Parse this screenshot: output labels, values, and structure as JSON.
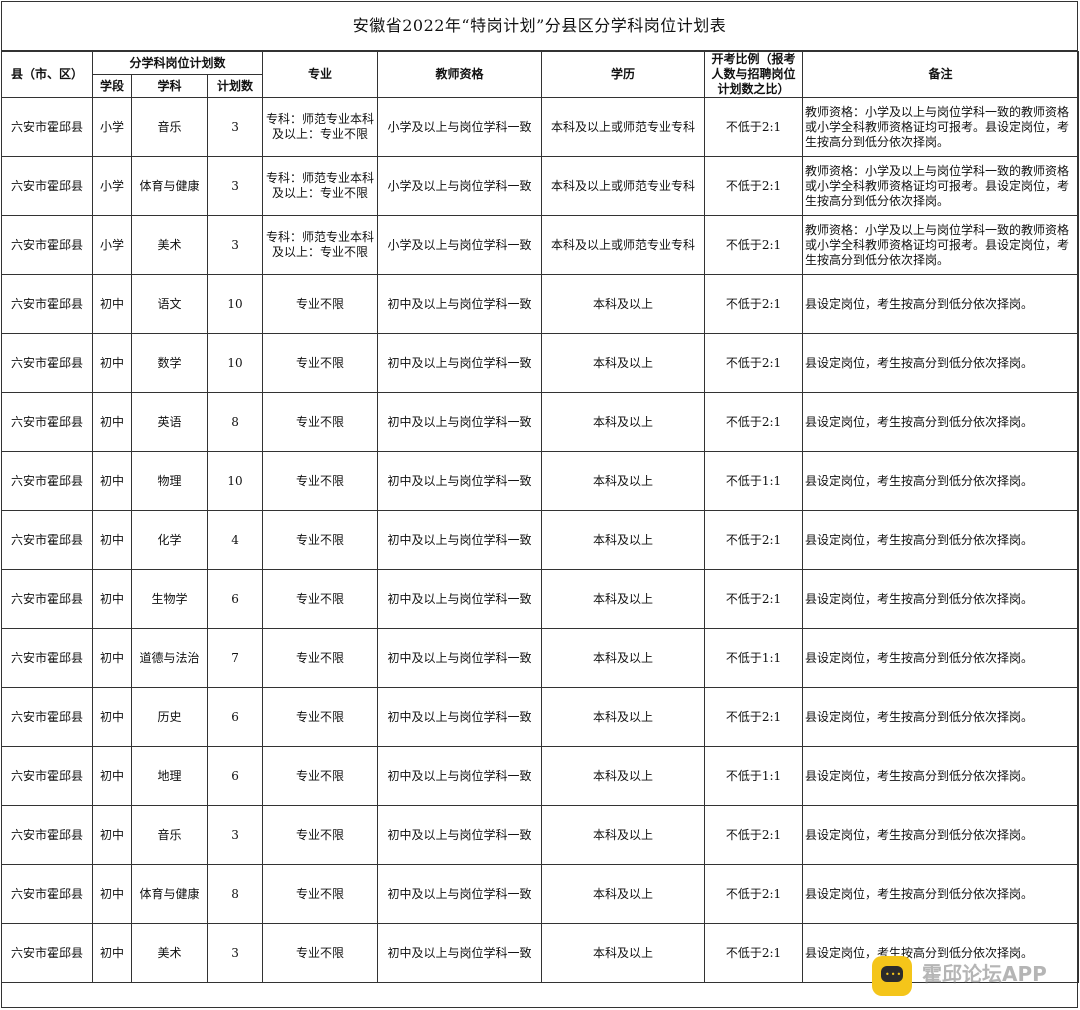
{
  "title": "安徽省2022年“特岗计划”分县区分学科岗位计划表",
  "headers": {
    "county": "县（市、区）",
    "plan_group": "分学科岗位计划数",
    "stage": "学段",
    "subject": "学科",
    "count": "计划数",
    "major": "专业",
    "qualification": "教师资格",
    "education": "学历",
    "ratio": "开考比例（报考人数与招聘岗位计划数之比）",
    "remark": "备注"
  },
  "rows": [
    {
      "county": "六安市霍邱县",
      "stage": "小学",
      "subject": "音乐",
      "count": "3",
      "major": "专科：师范专业本科及以上：专业不限",
      "qualification": "小学及以上与岗位学科一致",
      "education": "本科及以上或师范专业专科",
      "ratio": "不低于2:1",
      "remark": "教师资格：小学及以上与岗位学科一致的教师资格或小学全科教师资格证均可报考。县设定岗位，考生按高分到低分依次择岗。"
    },
    {
      "county": "六安市霍邱县",
      "stage": "小学",
      "subject": "体育与健康",
      "count": "3",
      "major": "专科：师范专业本科及以上：专业不限",
      "qualification": "小学及以上与岗位学科一致",
      "education": "本科及以上或师范专业专科",
      "ratio": "不低于2:1",
      "remark": "教师资格：小学及以上与岗位学科一致的教师资格或小学全科教师资格证均可报考。县设定岗位，考生按高分到低分依次择岗。"
    },
    {
      "county": "六安市霍邱县",
      "stage": "小学",
      "subject": "美术",
      "count": "3",
      "major": "专科：师范专业本科及以上：专业不限",
      "qualification": "小学及以上与岗位学科一致",
      "education": "本科及以上或师范专业专科",
      "ratio": "不低于2:1",
      "remark": "教师资格：小学及以上与岗位学科一致的教师资格或小学全科教师资格证均可报考。县设定岗位，考生按高分到低分依次择岗。"
    },
    {
      "county": "六安市霍邱县",
      "stage": "初中",
      "subject": "语文",
      "count": "10",
      "major": "专业不限",
      "qualification": "初中及以上与岗位学科一致",
      "education": "本科及以上",
      "ratio": "不低于2:1",
      "remark": "县设定岗位，考生按高分到低分依次择岗。"
    },
    {
      "county": "六安市霍邱县",
      "stage": "初中",
      "subject": "数学",
      "count": "10",
      "major": "专业不限",
      "qualification": "初中及以上与岗位学科一致",
      "education": "本科及以上",
      "ratio": "不低于2:1",
      "remark": "县设定岗位，考生按高分到低分依次择岗。"
    },
    {
      "county": "六安市霍邱县",
      "stage": "初中",
      "subject": "英语",
      "count": "8",
      "major": "专业不限",
      "qualification": "初中及以上与岗位学科一致",
      "education": "本科及以上",
      "ratio": "不低于2:1",
      "remark": "县设定岗位，考生按高分到低分依次择岗。"
    },
    {
      "county": "六安市霍邱县",
      "stage": "初中",
      "subject": "物理",
      "count": "10",
      "major": "专业不限",
      "qualification": "初中及以上与岗位学科一致",
      "education": "本科及以上",
      "ratio": "不低于1:1",
      "remark": "县设定岗位，考生按高分到低分依次择岗。"
    },
    {
      "county": "六安市霍邱县",
      "stage": "初中",
      "subject": "化学",
      "count": "4",
      "major": "专业不限",
      "qualification": "初中及以上与岗位学科一致",
      "education": "本科及以上",
      "ratio": "不低于2:1",
      "remark": "县设定岗位，考生按高分到低分依次择岗。"
    },
    {
      "county": "六安市霍邱县",
      "stage": "初中",
      "subject": "生物学",
      "count": "6",
      "major": "专业不限",
      "qualification": "初中及以上与岗位学科一致",
      "education": "本科及以上",
      "ratio": "不低于2:1",
      "remark": "县设定岗位，考生按高分到低分依次择岗。"
    },
    {
      "county": "六安市霍邱县",
      "stage": "初中",
      "subject": "道德与法治",
      "count": "7",
      "major": "专业不限",
      "qualification": "初中及以上与岗位学科一致",
      "education": "本科及以上",
      "ratio": "不低于1:1",
      "remark": "县设定岗位，考生按高分到低分依次择岗。"
    },
    {
      "county": "六安市霍邱县",
      "stage": "初中",
      "subject": "历史",
      "count": "6",
      "major": "专业不限",
      "qualification": "初中及以上与岗位学科一致",
      "education": "本科及以上",
      "ratio": "不低于2:1",
      "remark": "县设定岗位，考生按高分到低分依次择岗。"
    },
    {
      "county": "六安市霍邱县",
      "stage": "初中",
      "subject": "地理",
      "count": "6",
      "major": "专业不限",
      "qualification": "初中及以上与岗位学科一致",
      "education": "本科及以上",
      "ratio": "不低于1:1",
      "remark": "县设定岗位，考生按高分到低分依次择岗。"
    },
    {
      "county": "六安市霍邱县",
      "stage": "初中",
      "subject": "音乐",
      "count": "3",
      "major": "专业不限",
      "qualification": "初中及以上与岗位学科一致",
      "education": "本科及以上",
      "ratio": "不低于2:1",
      "remark": "县设定岗位，考生按高分到低分依次择岗。"
    },
    {
      "county": "六安市霍邱县",
      "stage": "初中",
      "subject": "体育与健康",
      "count": "8",
      "major": "专业不限",
      "qualification": "初中及以上与岗位学科一致",
      "education": "本科及以上",
      "ratio": "不低于2:1",
      "remark": "县设定岗位，考生按高分到低分依次择岗。"
    },
    {
      "county": "六安市霍邱县",
      "stage": "初中",
      "subject": "美术",
      "count": "3",
      "major": "专业不限",
      "qualification": "初中及以上与岗位学科一致",
      "education": "本科及以上",
      "ratio": "不低于2:1",
      "remark": "县设定岗位，考生按高分到低分依次择岗。"
    }
  ],
  "watermark": {
    "name": "霍邱论坛APP",
    "logo_color": "#f4c51a"
  }
}
